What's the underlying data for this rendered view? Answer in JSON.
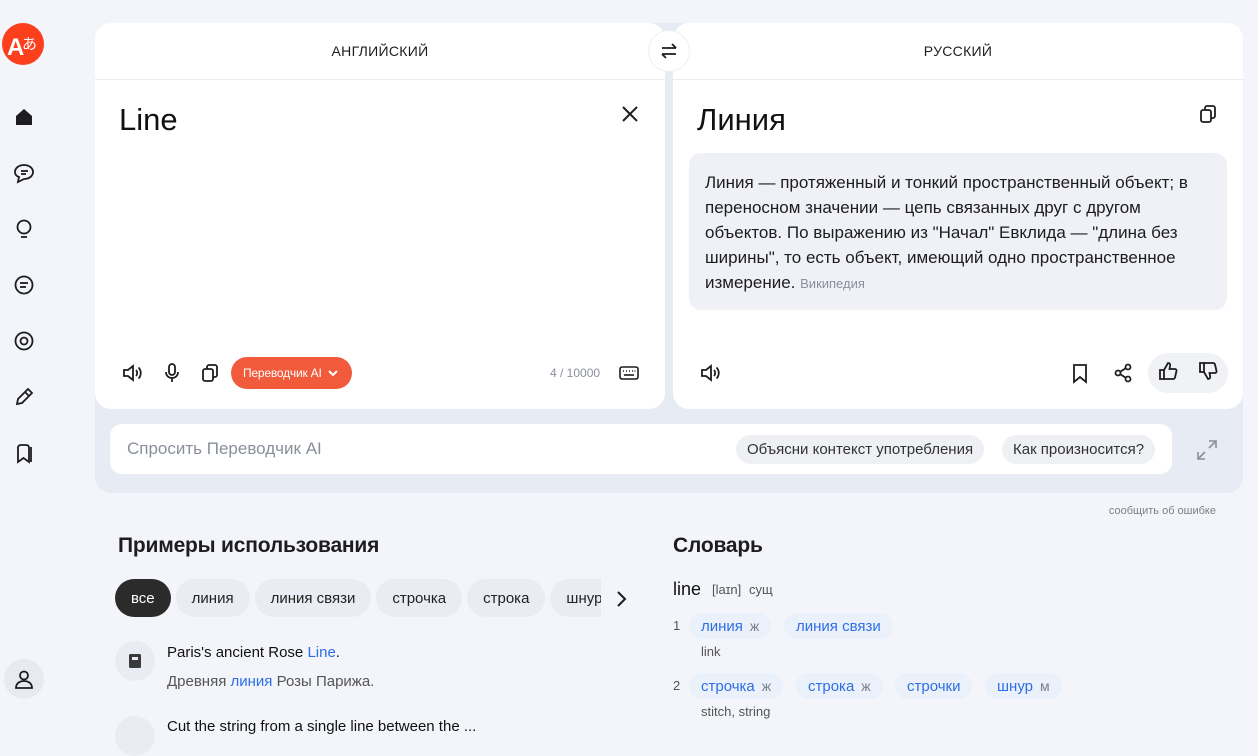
{
  "sidebar": {
    "logo": "translate-logo",
    "items": [
      "home-icon",
      "chat-icon",
      "lightbulb-icon",
      "document-icon",
      "camera-icon",
      "pencil-icon",
      "bookmarks-icon"
    ],
    "profile": "user-icon"
  },
  "source": {
    "language": "АНГЛИЙСКИЙ",
    "text": "Line",
    "counter": "4 / 10000",
    "ai_button": "Переводчик AI"
  },
  "target": {
    "language": "РУССКИЙ",
    "text": "Линия",
    "wiki_text": "Линия — протяженный и тонкий пространственный объект; в переносном значении — цепь связанных друг с другом объектов. По выражению из \"Начал\" Евклида — \"длина без ширины\", то есть объект, имеющий одно пространственное измерение.",
    "wiki_source": "Википедия"
  },
  "ask": {
    "placeholder": "Спросить Переводчик AI",
    "suggestions": [
      "Объясни контекст употребления",
      "Как произносится?"
    ]
  },
  "report_link": "сообщить об ошибке",
  "examples": {
    "title": "Примеры использования",
    "filters": [
      "все",
      "линия",
      "линия связи",
      "строчка",
      "строка",
      "шнур"
    ],
    "items": [
      {
        "en_before": "Paris's ancient Rose ",
        "en_hl": "Line",
        "en_after": ".",
        "ru_before": "Древняя ",
        "ru_hl": "линия",
        "ru_after": " Розы Парижа."
      }
    ],
    "next_partial": "Cut the string from a single line between the ..."
  },
  "dictionary": {
    "title": "Словарь",
    "word": "line",
    "transcription": "[laɪn]",
    "pos": "сущ",
    "senses": [
      {
        "num": "1",
        "translations": [
          {
            "word": "линия",
            "gender": "ж"
          },
          {
            "word": "линия связи",
            "gender": ""
          }
        ],
        "synonyms": "link"
      },
      {
        "num": "2",
        "translations": [
          {
            "word": "строчка",
            "gender": "ж"
          },
          {
            "word": "строка",
            "gender": "ж"
          },
          {
            "word": "строчки",
            "gender": ""
          },
          {
            "word": "шнур",
            "gender": "м"
          }
        ],
        "synonyms": "stitch, string"
      }
    ]
  },
  "colors": {
    "accent": "#f25a3c",
    "link": "#2f6fe4",
    "background": "#f3f5fa"
  }
}
